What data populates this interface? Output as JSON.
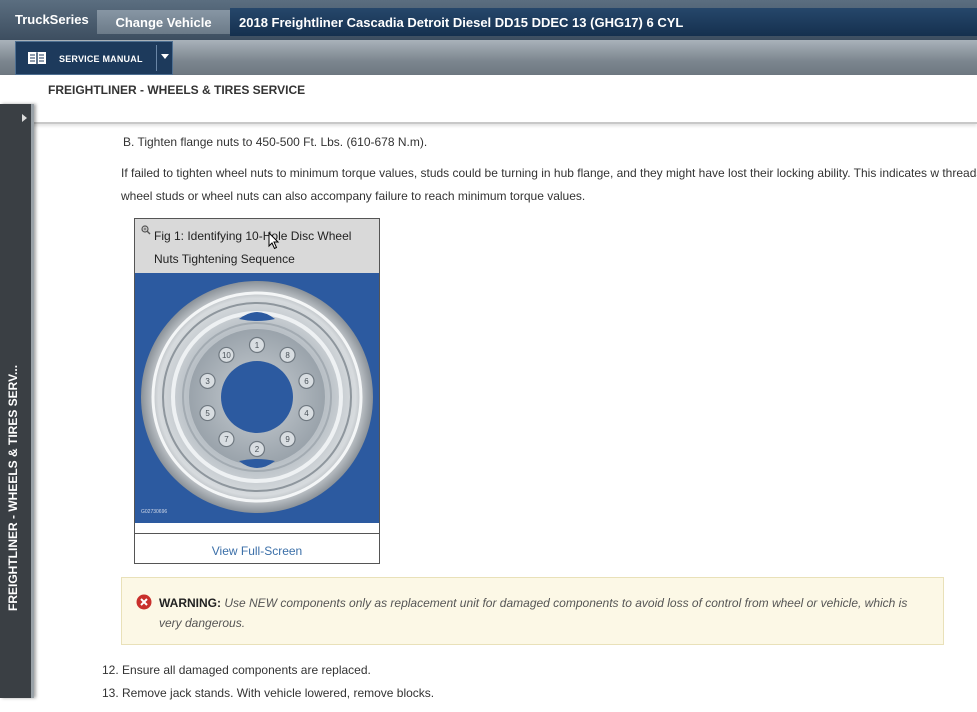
{
  "header": {
    "brand": "TruckSeries",
    "change_vehicle": "Change Vehicle",
    "vehicle_title": "2018 Freightliner Cascadia Detroit Diesel DD15 DDEC 13 (GHG17) 6 CYL"
  },
  "toolbar": {
    "service_manual": "SERVICE MANUAL",
    "icon": "book-icon"
  },
  "section": {
    "title": "FREIGHTLINER - WHEELS & TIRES SERVICE"
  },
  "side_tab": {
    "label": "FREIGHTLINER - WHEELS & TIRES SERV..."
  },
  "content": {
    "step_b": "B. Tighten flange nuts to 450-500 Ft. Lbs. (610-678 N.m).",
    "paragraph": "If failed to tighten wheel nuts to minimum torque values, studs could be turning in hub flange, and they might have lost their locking ability. This indicates w threads on wheel studs or wheel nuts can also accompany failure to reach minimum torque values.",
    "figure": {
      "caption": "Fig 1: Identifying 10-Hole Disc Wheel Nuts Tightening Sequence",
      "image_code": "G02730696",
      "link": "View Full-Screen",
      "nut_labels": [
        "1",
        "8",
        "6",
        "4",
        "9",
        "2",
        "7",
        "5",
        "3",
        "10"
      ]
    },
    "warning": {
      "label": "WARNING:",
      "text": "Use NEW components only as replacement unit for damaged components to avoid loss of control from wheel or vehicle, which is very dangerous."
    },
    "step_12": "12. Ensure all damaged components are replaced.",
    "step_13": "13. Remove jack stands. With vehicle lowered, remove blocks."
  },
  "colors": {
    "nav_dark": "#1d3a5c",
    "figure_background": "#2c5aa0",
    "warning_background": "#fcf8e6",
    "warning_icon": "#c9302c",
    "link": "#3b6fa8"
  }
}
